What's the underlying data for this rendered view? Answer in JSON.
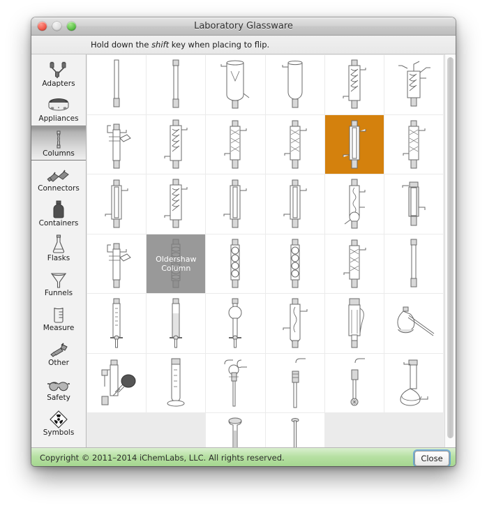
{
  "window": {
    "title": "Laboratory Glassware",
    "traffic_lights": [
      {
        "name": "close",
        "color": "#f05a4c"
      },
      {
        "name": "minimize",
        "color": "#dcdcdc"
      },
      {
        "name": "zoom",
        "color": "#5ec24a"
      }
    ]
  },
  "hint": {
    "prefix": "Hold down the ",
    "emphasis": "shift",
    "suffix": " key when placing to flip."
  },
  "sidebar": {
    "selected": "Columns",
    "items": [
      {
        "label": "Adapters",
        "icon": "adapters-icon"
      },
      {
        "label": "Appliances",
        "icon": "hotplate-icon"
      },
      {
        "label": "Columns",
        "icon": "column-icon"
      },
      {
        "label": "Connectors",
        "icon": "connectors-icon"
      },
      {
        "label": "Containers",
        "icon": "bottle-icon"
      },
      {
        "label": "Flasks",
        "icon": "erlenmeyer-flask-icon"
      },
      {
        "label": "Funnels",
        "icon": "funnel-icon"
      },
      {
        "label": "Measure",
        "icon": "beaker-icon"
      },
      {
        "label": "Other",
        "icon": "faucet-icon"
      },
      {
        "label": "Safety",
        "icon": "goggles-icon"
      },
      {
        "label": "Symbols",
        "icon": "radiation-icon"
      }
    ]
  },
  "grid": {
    "columns": 6,
    "rows": 7,
    "selected_index": 16,
    "hovered_index": 19,
    "tooltip": "Oldershaw Column",
    "selection_color": "#d4810d",
    "cells": [
      {
        "index": 0,
        "glyph": "plain-tube",
        "state": "normal"
      },
      {
        "index": 1,
        "glyph": "plain-tube-joint",
        "state": "normal"
      },
      {
        "index": 2,
        "glyph": "wide-vessel",
        "state": "normal"
      },
      {
        "index": 3,
        "glyph": "wide-vessel-round",
        "state": "normal"
      },
      {
        "index": 4,
        "glyph": "coil-condenser",
        "state": "normal"
      },
      {
        "index": 5,
        "glyph": "coil-side-arm",
        "state": "normal"
      },
      {
        "index": 6,
        "glyph": "side-arm-column",
        "state": "normal"
      },
      {
        "index": 7,
        "glyph": "coil-condenser",
        "state": "normal"
      },
      {
        "index": 8,
        "glyph": "vigreux-column",
        "state": "normal"
      },
      {
        "index": 9,
        "glyph": "vigreux-column",
        "state": "normal"
      },
      {
        "index": 10,
        "glyph": "liebig-condenser",
        "state": "selected"
      },
      {
        "index": 11,
        "glyph": "vigreux-column",
        "state": "normal"
      },
      {
        "index": 12,
        "glyph": "liebig-condenser",
        "state": "normal"
      },
      {
        "index": 13,
        "glyph": "coil-condenser",
        "state": "normal"
      },
      {
        "index": 14,
        "glyph": "liebig-condenser",
        "state": "normal"
      },
      {
        "index": 15,
        "glyph": "liebig-condenser",
        "state": "normal"
      },
      {
        "index": 16,
        "glyph": "bulb-condenser",
        "state": "normal"
      },
      {
        "index": 17,
        "glyph": "jacketed-column",
        "state": "normal"
      },
      {
        "index": 18,
        "glyph": "side-arm-column",
        "state": "normal"
      },
      {
        "index": 19,
        "glyph": "oldershaw-column",
        "state": "hovered"
      },
      {
        "index": 20,
        "glyph": "bubble-column",
        "state": "normal"
      },
      {
        "index": 21,
        "glyph": "bubble-column",
        "state": "normal"
      },
      {
        "index": 22,
        "glyph": "vigreux-column",
        "state": "normal"
      },
      {
        "index": 23,
        "glyph": "plain-tube-joint",
        "state": "normal"
      },
      {
        "index": 24,
        "glyph": "burette",
        "state": "normal"
      },
      {
        "index": 25,
        "glyph": "packed-burette",
        "state": "normal"
      },
      {
        "index": 26,
        "glyph": "bulb-burette",
        "state": "normal"
      },
      {
        "index": 27,
        "glyph": "jacketed-condenser",
        "state": "normal"
      },
      {
        "index": 28,
        "glyph": "soxhlet-extractor",
        "state": "normal"
      },
      {
        "index": 29,
        "glyph": "retort-flask",
        "state": "normal"
      },
      {
        "index": 30,
        "glyph": "gas-washing-bottle",
        "state": "normal"
      },
      {
        "index": 31,
        "glyph": "graduated-cylinder",
        "state": "normal"
      },
      {
        "index": 32,
        "glyph": "gas-inlet-tube",
        "state": "normal"
      },
      {
        "index": 33,
        "glyph": "sparge-tube",
        "state": "normal"
      },
      {
        "index": 34,
        "glyph": "frit-sparge-tube",
        "state": "normal"
      },
      {
        "index": 35,
        "glyph": "volumetric-flask",
        "state": "normal"
      },
      {
        "index": 36,
        "glyph": null,
        "state": "empty"
      },
      {
        "index": 37,
        "glyph": null,
        "state": "empty"
      },
      {
        "index": 38,
        "glyph": "thermometer-probe",
        "state": "normal"
      },
      {
        "index": 39,
        "glyph": "thin-rod",
        "state": "normal"
      },
      {
        "index": 40,
        "glyph": null,
        "state": "empty"
      },
      {
        "index": 41,
        "glyph": null,
        "state": "empty"
      }
    ]
  },
  "scrollbar": {
    "name": "vertical-scrollbar",
    "position": "top"
  },
  "footer": {
    "copyright": "Copyright © 2011–2014 iChemLabs, LLC. All rights reserved.",
    "close_label": "Close"
  }
}
